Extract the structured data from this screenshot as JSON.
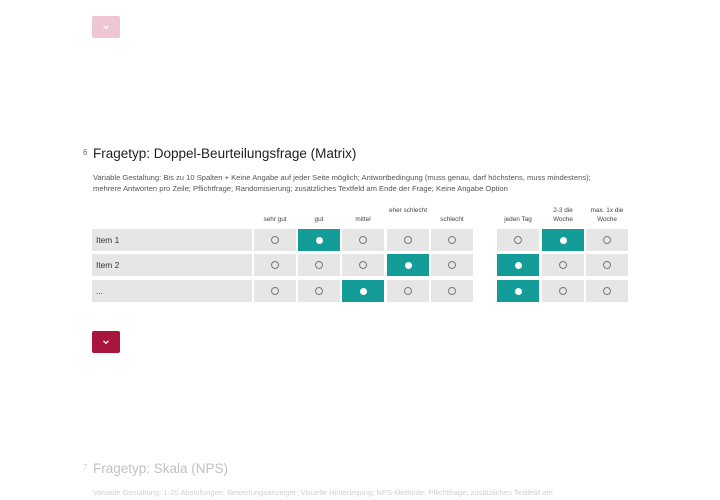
{
  "nav": {
    "top_button_icon": "chevron-down-icon",
    "bottom_button_icon": "chevron-down-icon"
  },
  "question6": {
    "number": "6",
    "title": "Fragetyp: Doppel-Beurteilungsfrage (Matrix)",
    "description": "Variable Gestaltung: Bis zu 10 Spalten + Keine Angabe auf jeder Seite möglich; Antwortbedingung (muss genau, darf höchstens, muss mindestens); mehrere Antworten pro Zeile; Pflichtfrage; Randomisierung; zusätzliches Textfeld am Ende der Frage; Keine Angabe Option",
    "matrix": {
      "left_columns": [
        "sehr gut",
        "gut",
        "mittel",
        "eher schlecht",
        "schlecht"
      ],
      "right_columns": [
        "jeden Tag",
        "2-3 die Woche",
        "max. 1x die Woche"
      ],
      "rows": [
        {
          "label": "Item 1",
          "left_selected": "gut",
          "right_selected": "2-3 die Woche"
        },
        {
          "label": "Item 2",
          "left_selected": "eher schlecht",
          "right_selected": "jeden Tag"
        },
        {
          "label": "...",
          "left_selected": "mittel",
          "right_selected": "jeden Tag"
        }
      ],
      "selected_color": "#139c98"
    }
  },
  "question7": {
    "number": "7",
    "title": "Fragetyp: Skala (NPS)",
    "description": "Variable Gestaltung: 1-20 Abstufungen; Bewertungsanzeiger; Visuelle Hinterlegung; NPS-Methode; Pflichtfrage; zusätzliches Textfeld am"
  },
  "colors": {
    "accent": "#a8153f",
    "accent_light": "#efc7d2",
    "cell_bg": "#e6e6e6"
  }
}
